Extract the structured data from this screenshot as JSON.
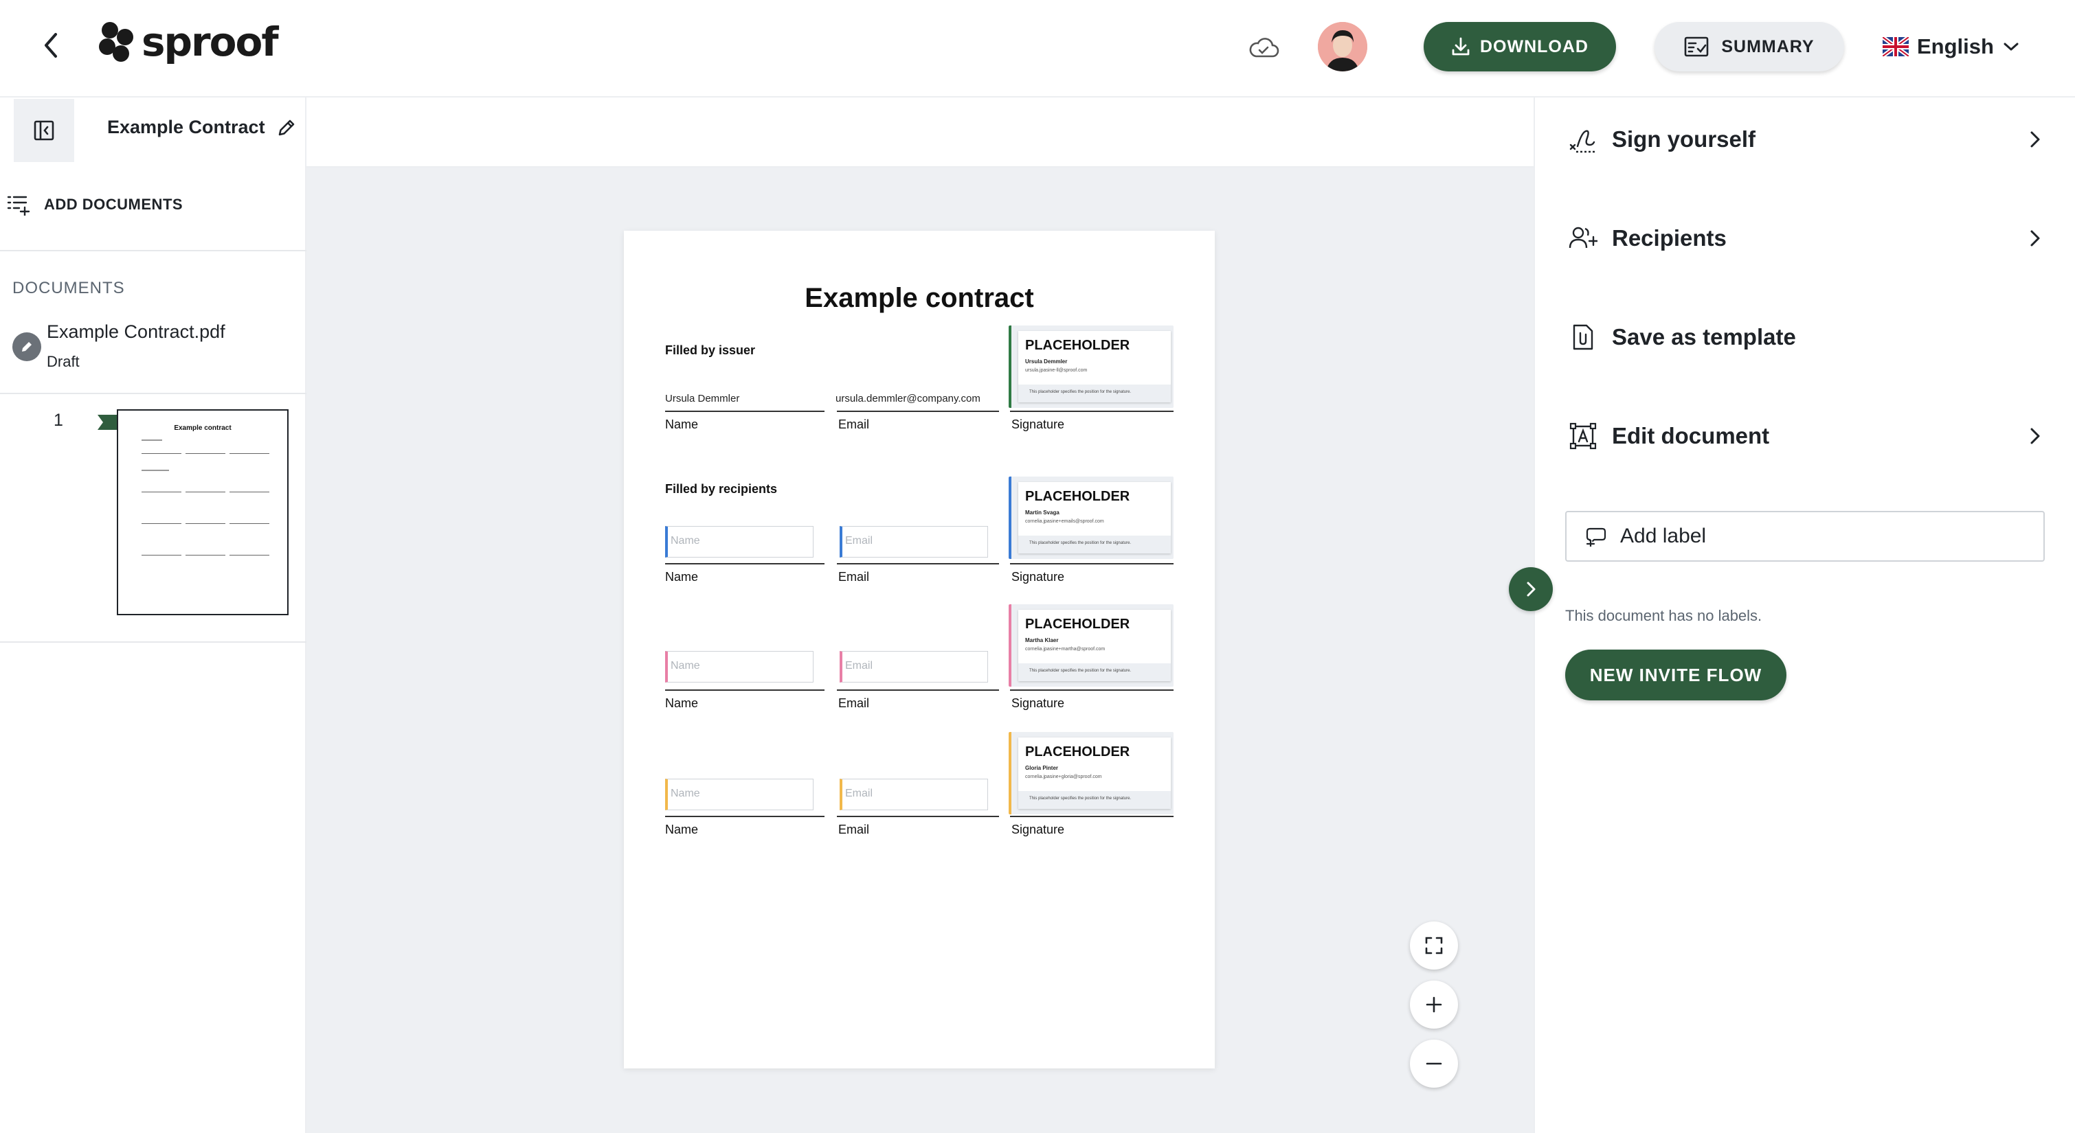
{
  "header": {
    "logo_text": "sproof",
    "download_label": "DOWNLOAD",
    "summary_label": "SUMMARY",
    "language": "English"
  },
  "sidebar": {
    "add_documents_label": "ADD DOCUMENTS",
    "documents_title": "DOCUMENTS",
    "document": {
      "name": "Example Contract.pdf",
      "status": "Draft"
    },
    "page_number": "1"
  },
  "titlebar": {
    "document_title": "Example Contract"
  },
  "contract": {
    "title": "Example contract",
    "section_issuer": "Filled by issuer",
    "section_recipients": "Filled by recipients",
    "label_name": "Name",
    "label_email": "Email",
    "label_signature": "Signature",
    "issuer_name": "Ursula Demmler",
    "issuer_email": "ursula.demmler@company.com",
    "placeholder_name": "Name",
    "placeholder_email": "Email",
    "signature_placeholder": "PLACEHOLDER",
    "signatures": [
      {
        "name": "Ursula Demmler",
        "email": "ursula.jpasine-ll@sproof.com",
        "note": "This placeholder specifies the position for the signature.",
        "color": "#2f7a44"
      },
      {
        "name": "Martin Svaga",
        "email": "cornelia.jpasine+emails@sproof.com",
        "note": "This placeholder specifies the position for the signature.",
        "color": "#3a7bd5"
      },
      {
        "name": "Martha Klaer",
        "email": "cornelia.jpasine+martha@sproof.com",
        "note": "This placeholder specifies the position for the signature.",
        "color": "#e87fa6"
      },
      {
        "name": "Gloria Pinter",
        "email": "cornelia.jpasine+gloria@sproof.com",
        "note": "This placeholder specifies the position for the signature.",
        "color": "#f2b84b"
      }
    ],
    "thumb_title": "Example contract"
  },
  "rightpanel": {
    "sign_yourself": "Sign yourself",
    "recipients": "Recipients",
    "save_as_template": "Save as template",
    "edit_document": "Edit document",
    "add_label_placeholder": "Add label",
    "no_labels_text": "This document has no labels.",
    "new_invite_flow": "NEW INVITE FLOW"
  },
  "colors": {
    "primary": "#2f5d3e",
    "canvas_bg": "#eef0f3"
  }
}
